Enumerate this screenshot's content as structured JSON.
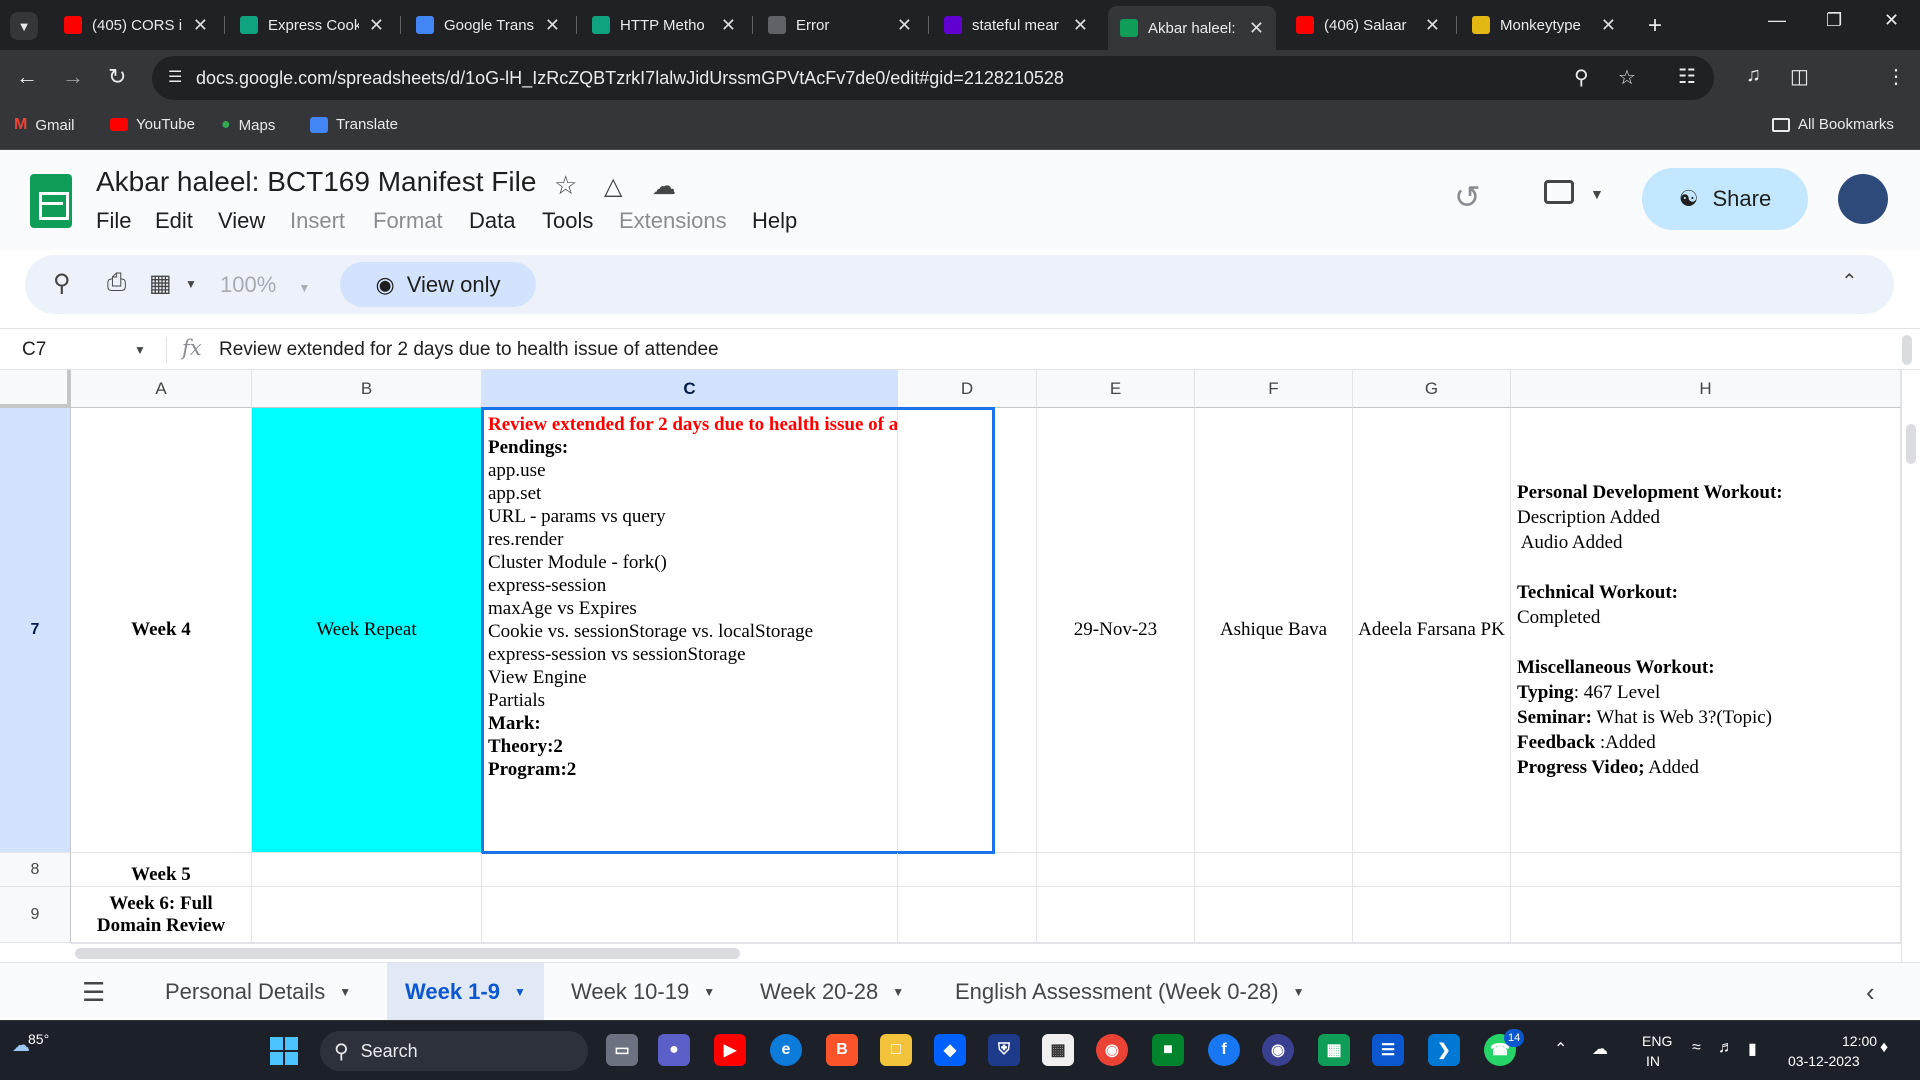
{
  "browser": {
    "tabs": [
      {
        "title": "(405) CORS i",
        "favicon": "youtube",
        "color": "#ff0000",
        "active": false
      },
      {
        "title": "Express Cook",
        "favicon": "chatgpt",
        "color": "#10a37f",
        "active": false
      },
      {
        "title": "Google Trans",
        "favicon": "google-translate",
        "color": "#4285f4",
        "active": false
      },
      {
        "title": "HTTP Metho",
        "favicon": "chatgpt",
        "color": "#10a37f",
        "active": false
      },
      {
        "title": "Error",
        "favicon": "globe",
        "color": "#5f6368",
        "active": false
      },
      {
        "title": "stateful mear",
        "favicon": "yahoo",
        "color": "#6001d2",
        "active": false
      },
      {
        "title": "Akbar haleel:",
        "favicon": "google-sheets",
        "color": "#0f9d58",
        "active": true
      },
      {
        "title": "(406) Salaar",
        "favicon": "youtube",
        "color": "#ff0000",
        "active": false
      },
      {
        "title": "Monkeytype",
        "favicon": "monkeytype",
        "color": "#e2b714",
        "active": false
      }
    ],
    "url": "docs.google.com/spreadsheets/d/1oG-lH_IzRcZQBTzrkI7lalwJidUrssmGPVtAcFv7de0/edit#gid=2128210528",
    "bookmarks": [
      {
        "label": "Gmail",
        "icon": "gmail-icon"
      },
      {
        "label": "YouTube",
        "icon": "youtube-icon"
      },
      {
        "label": "Maps",
        "icon": "maps-icon"
      },
      {
        "label": "Translate",
        "icon": "translate-icon"
      }
    ],
    "all_bookmarks": "All Bookmarks"
  },
  "doc": {
    "title": "Akbar haleel: BCT169 Manifest File",
    "menus": [
      {
        "label": "File",
        "enabled": true
      },
      {
        "label": "Edit",
        "enabled": true
      },
      {
        "label": "View",
        "enabled": true
      },
      {
        "label": "Insert",
        "enabled": false
      },
      {
        "label": "Format",
        "enabled": false
      },
      {
        "label": "Data",
        "enabled": true
      },
      {
        "label": "Tools",
        "enabled": true
      },
      {
        "label": "Extensions",
        "enabled": false
      },
      {
        "label": "Help",
        "enabled": true
      }
    ],
    "share_label": "Share",
    "zoom": "100%",
    "view_only_label": "View only"
  },
  "formula_bar": {
    "cell_ref": "C7",
    "fx": "fx",
    "content": "Review extended for 2 days due to health issue of attendee"
  },
  "grid": {
    "columns": [
      "A",
      "B",
      "C",
      "D",
      "E",
      "F",
      "G",
      "H"
    ],
    "selected_column": "C",
    "rows": [
      {
        "num": "7",
        "selected": true
      },
      {
        "num": "8",
        "selected": false
      },
      {
        "num": "9",
        "selected": false
      }
    ],
    "row7": {
      "A": "Week 4",
      "B": "Week Repeat",
      "B_fill": "#00ffff",
      "C_lines": [
        {
          "text": "Review extended for 2 days due to health issue of attendee",
          "style": "red"
        },
        {
          "text": "Pendings:",
          "style": "bold"
        },
        {
          "text": "app.use",
          "style": "normal"
        },
        {
          "text": "app.set",
          "style": "normal"
        },
        {
          "text": "URL - params vs query",
          "style": "normal"
        },
        {
          "text": "res.render",
          "style": "normal"
        },
        {
          "text": "Cluster Module - fork()",
          "style": "normal"
        },
        {
          "text": "express-session",
          "style": "normal"
        },
        {
          "text": "maxAge vs Expires",
          "style": "normal"
        },
        {
          "text": "Cookie vs. sessionStorage vs. localStorage",
          "style": "normal"
        },
        {
          "text": "express-session vs sessionStorage",
          "style": "normal"
        },
        {
          "text": "View Engine",
          "style": "normal"
        },
        {
          "text": "Partials",
          "style": "normal"
        },
        {
          "text": "Mark:",
          "style": "bold"
        },
        {
          "text": "Theory:2",
          "style": "bold"
        },
        {
          "text": "Program:2",
          "style": "bold"
        }
      ],
      "E": "29-Nov-23",
      "F": "Ashique Bava",
      "G": "Adeela Farsana PK",
      "H_lines": [
        {
          "label": "Personal Development Workout:",
          "value": ""
        },
        {
          "label": "",
          "value": "Description Added"
        },
        {
          "label": "",
          "value": " Audio Added"
        },
        {
          "label": "",
          "value": ""
        },
        {
          "label": "Technical Workout:",
          "value": ""
        },
        {
          "label": "",
          "value": "Completed"
        },
        {
          "label": "",
          "value": ""
        },
        {
          "label": "Miscellaneous Workout:",
          "value": ""
        },
        {
          "label": "Typing",
          "value": ": 467 Level"
        },
        {
          "label": "Seminar:",
          "value": " What is Web 3?(Topic)"
        },
        {
          "label": "Feedback",
          "value": " :Added"
        },
        {
          "label": "Progress Video;",
          "value": " Added"
        }
      ]
    },
    "row8": {
      "A": "Week 5"
    },
    "row9": {
      "A": "Week 6: Full Domain Review"
    }
  },
  "sheet_tabs": [
    {
      "label": "Personal Details",
      "active": false
    },
    {
      "label": "Week 1-9",
      "active": true
    },
    {
      "label": "Week 10-19",
      "active": false
    },
    {
      "label": "Week 20-28",
      "active": false
    },
    {
      "label": "English Assessment (Week 0-28)",
      "active": false
    }
  ],
  "taskbar": {
    "weather": "85°",
    "search_label": "Search",
    "lang_top": "ENG",
    "lang_bottom": "IN",
    "time": "12:00",
    "date": "03-12-2023",
    "whatsapp_badge": "14"
  }
}
